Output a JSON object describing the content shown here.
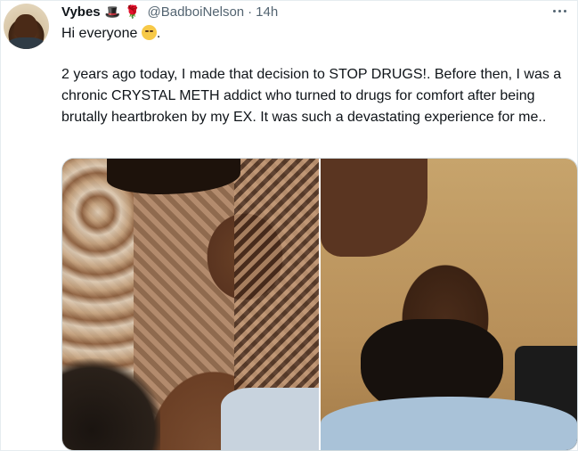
{
  "tweet": {
    "display_name": "Vybes",
    "name_emojis": [
      "🎩",
      "🌹"
    ],
    "handle": "@BadboiNelson",
    "separator": "·",
    "time": "14h",
    "text_line1": "Hi everyone",
    "text_line1_suffix": ".",
    "text_paragraph2": "2 years ago today, I made that decision to STOP DRUGS!. Before then, I was a chronic CRYSTAL METH addict who turned to drugs for comfort after being brutally heartbroken by my EX.  It was such a devastating experience for me..",
    "media": [
      {
        "kind": "photo",
        "description_icon": "photo-left"
      },
      {
        "kind": "photo",
        "description_icon": "photo-right"
      }
    ]
  },
  "colors": {
    "text": "#0f1419",
    "secondary": "#536471",
    "border": "#cfd9de"
  }
}
